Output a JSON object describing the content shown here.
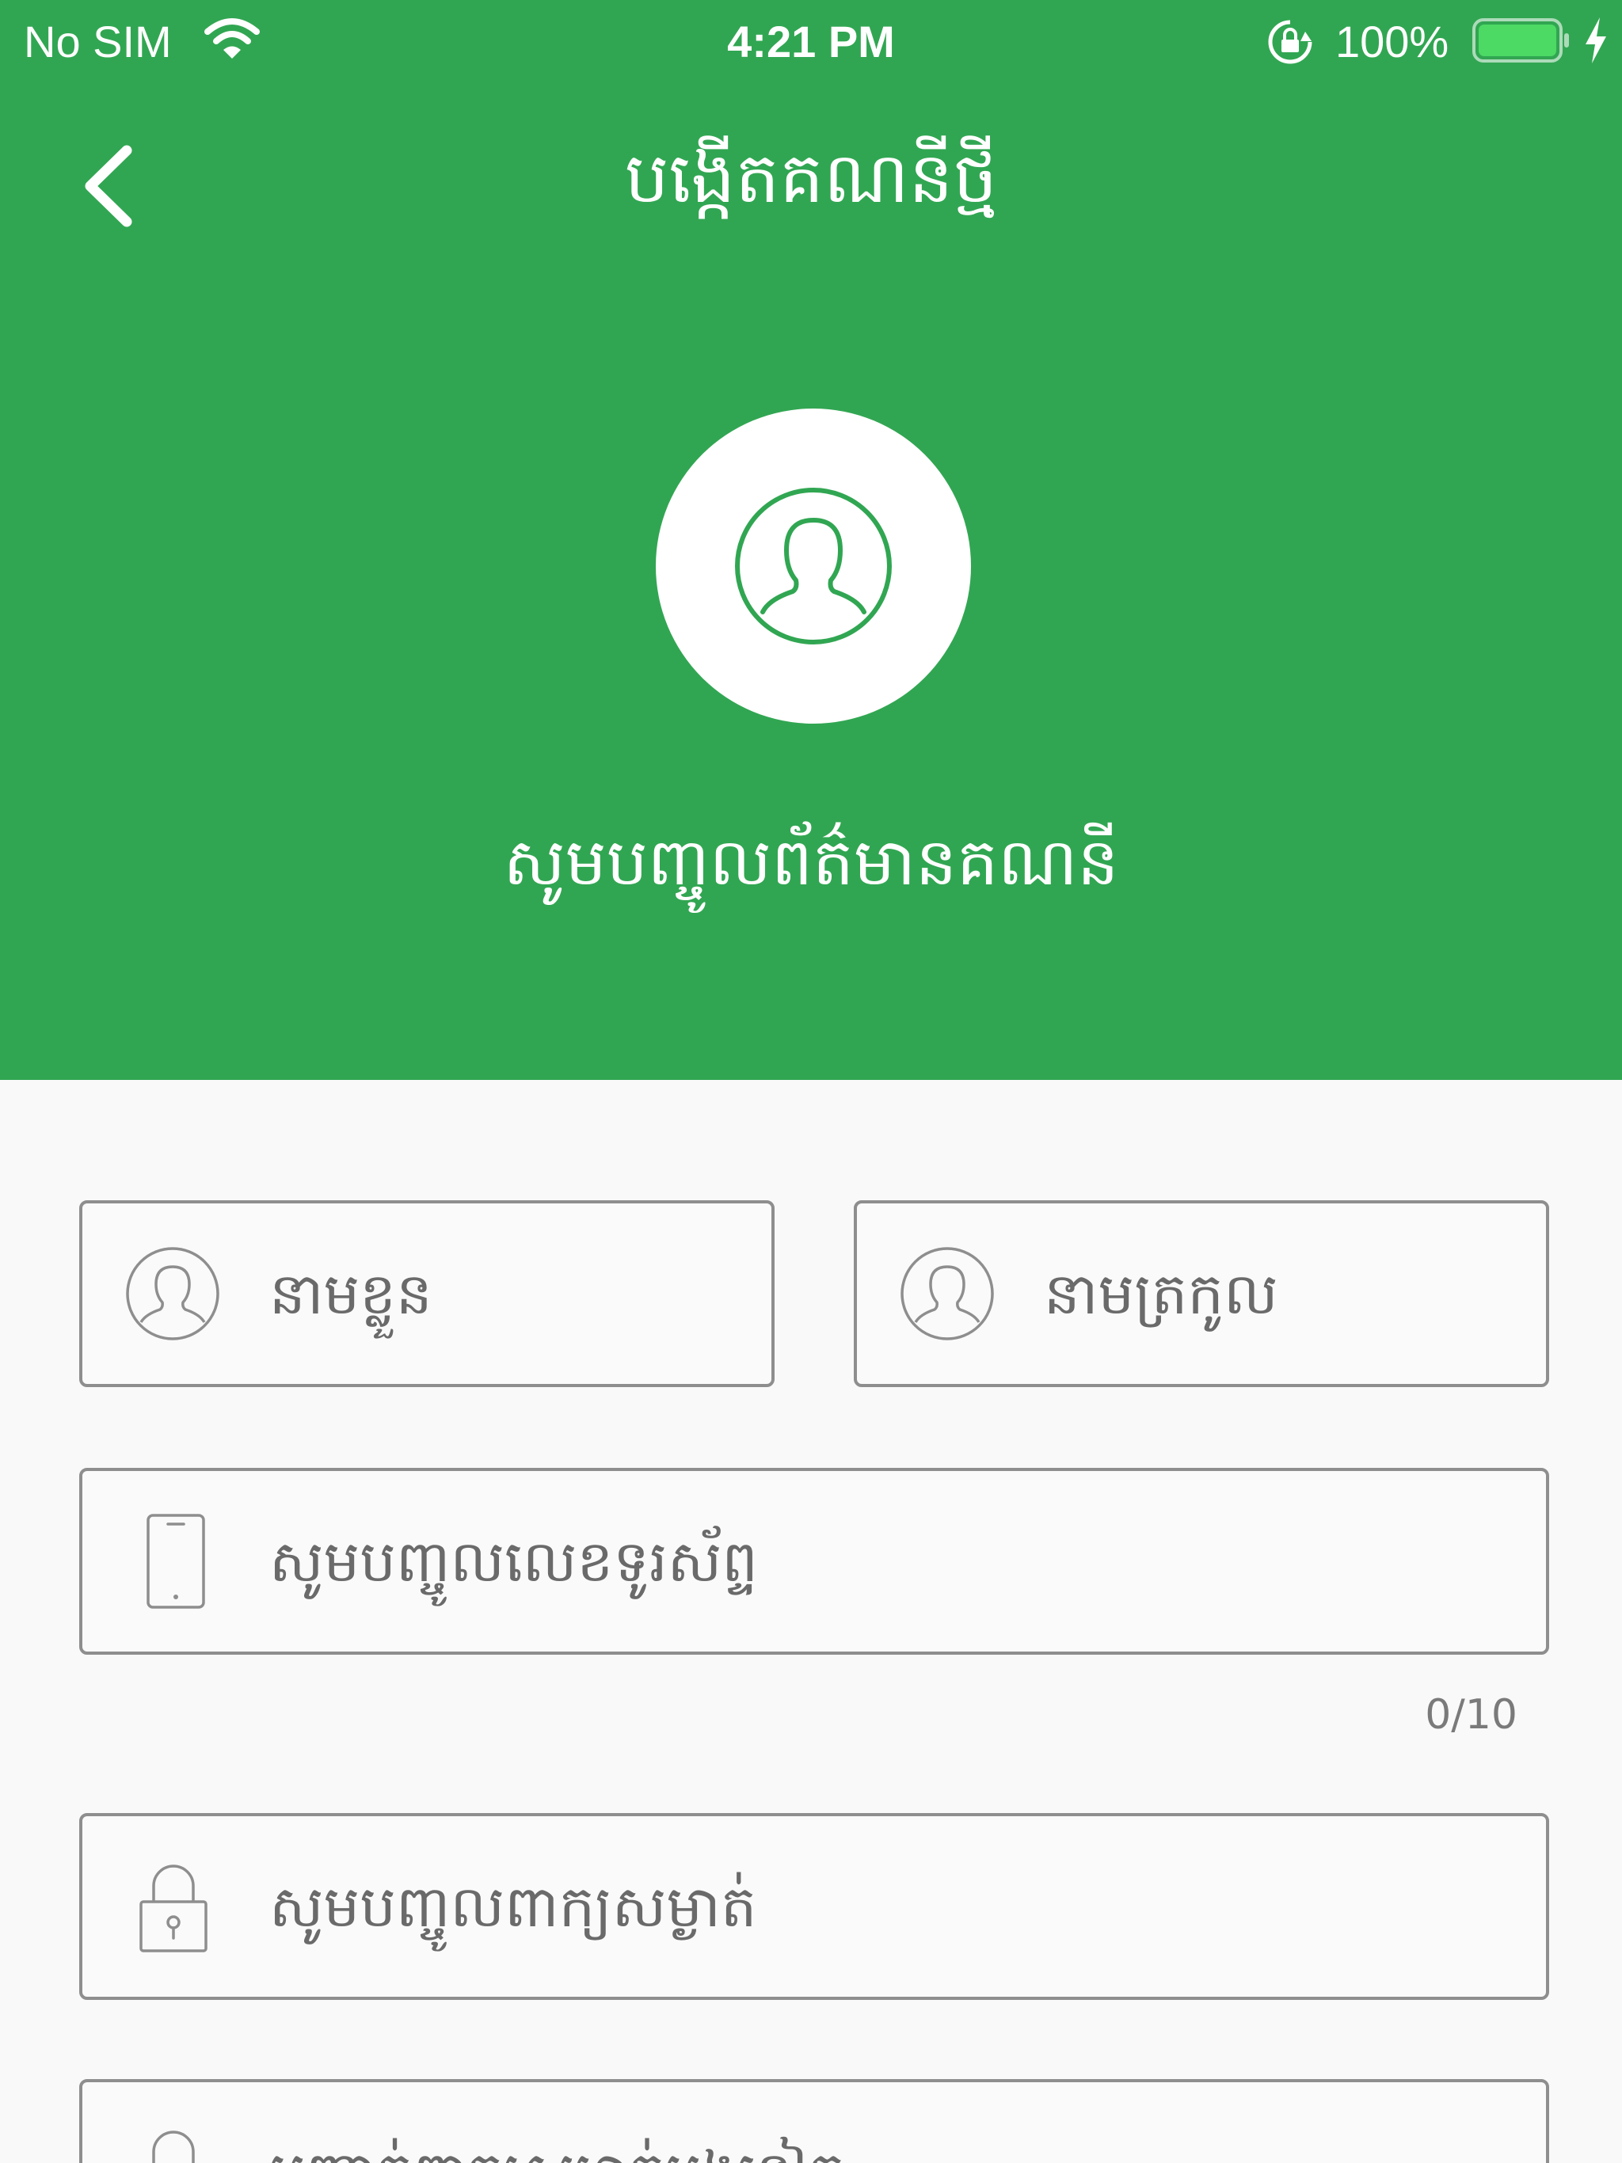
{
  "status_bar": {
    "carrier": "No SIM",
    "time": "4:21 PM",
    "battery_percent": "100%",
    "wifi_icon": "wifi-icon",
    "rotation_lock_icon": "rotation-lock-icon",
    "battery_icon": "battery-icon",
    "charging_icon": "charging-bolt-icon",
    "battery_level": 1.0
  },
  "nav": {
    "title": "បង្កើតគណនីថ្មី",
    "back_icon": "chevron-left-icon"
  },
  "header": {
    "avatar_icon": "user-profile-icon",
    "subtitle": "សូមបញ្ចូលព័ត៌មានគណនី"
  },
  "form": {
    "first_name": {
      "placeholder": "នាមខ្លួន",
      "icon": "user-icon"
    },
    "last_name": {
      "placeholder": "នាមត្រកូល",
      "icon": "user-icon"
    },
    "phone": {
      "placeholder": "សូមបញ្ចូលលេខទូរស័ព្ទ",
      "icon": "phone-icon",
      "counter": "0/10"
    },
    "password": {
      "placeholder": "សូមបញ្ចូលពាក្យសម្ងាត់",
      "icon": "lock-icon"
    },
    "confirm_password": {
      "placeholder": "បញ្ជាក់ពាក្យសម្ងាត់ម្តងទៀត",
      "icon": "lock-icon"
    }
  },
  "colors": {
    "header_green": "#31a652",
    "battery_green": "#4cd964",
    "field_border": "#8e8e8e",
    "background": "#f9f9f9"
  }
}
